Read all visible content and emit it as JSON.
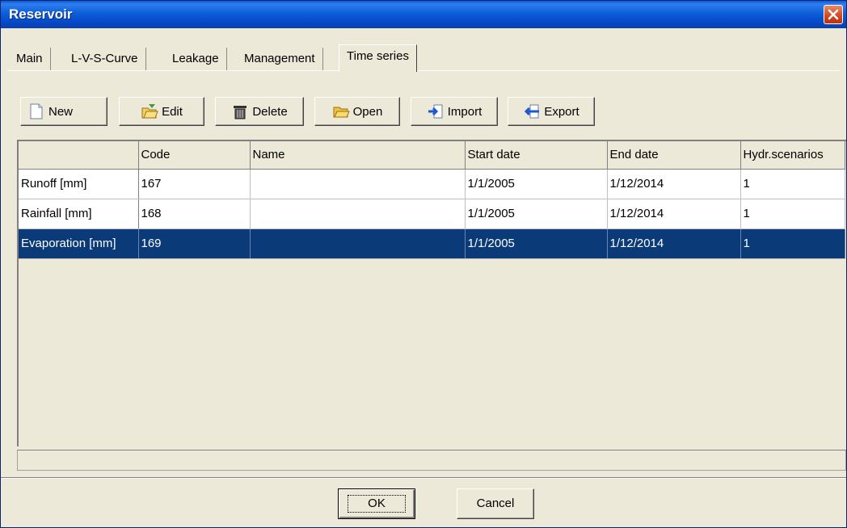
{
  "window": {
    "title": "Reservoir"
  },
  "tabs": [
    {
      "label": "Main"
    },
    {
      "label": "L-V-S-Curve"
    },
    {
      "label": "Leakage"
    },
    {
      "label": "Management"
    },
    {
      "label": "Time series",
      "active": true
    }
  ],
  "toolbar": {
    "new_label": "New",
    "edit_label": "Edit",
    "delete_label": "Delete",
    "open_label": "Open",
    "import_label": "Import",
    "export_label": "Export"
  },
  "table": {
    "columns": [
      "",
      "Code",
      "Name",
      "Start date",
      "End date",
      "Hydr.scenarios"
    ],
    "rows": [
      {
        "label": "Runoff [mm]",
        "code": "167",
        "name": "",
        "start": "1/1/2005",
        "end": "1/12/2014",
        "scenarios": "1"
      },
      {
        "label": "Rainfall [mm]",
        "code": "168",
        "name": "",
        "start": "1/1/2005",
        "end": "1/12/2014",
        "scenarios": "1"
      },
      {
        "label": "Evaporation [mm]",
        "code": "169",
        "name": "",
        "start": "1/1/2005",
        "end": "1/12/2014",
        "scenarios": "1",
        "selected": true
      }
    ]
  },
  "buttons": {
    "ok_label": "OK",
    "cancel_label": "Cancel"
  },
  "colors": {
    "title_bar": "#0548c8",
    "selection": "#0a3a78",
    "face": "#ece9d8",
    "close": "#d2451f"
  },
  "icons": [
    "close-icon",
    "new-document-icon",
    "edit-folder-icon",
    "trash-icon",
    "open-folder-icon",
    "import-arrow-icon",
    "export-arrow-icon"
  ]
}
